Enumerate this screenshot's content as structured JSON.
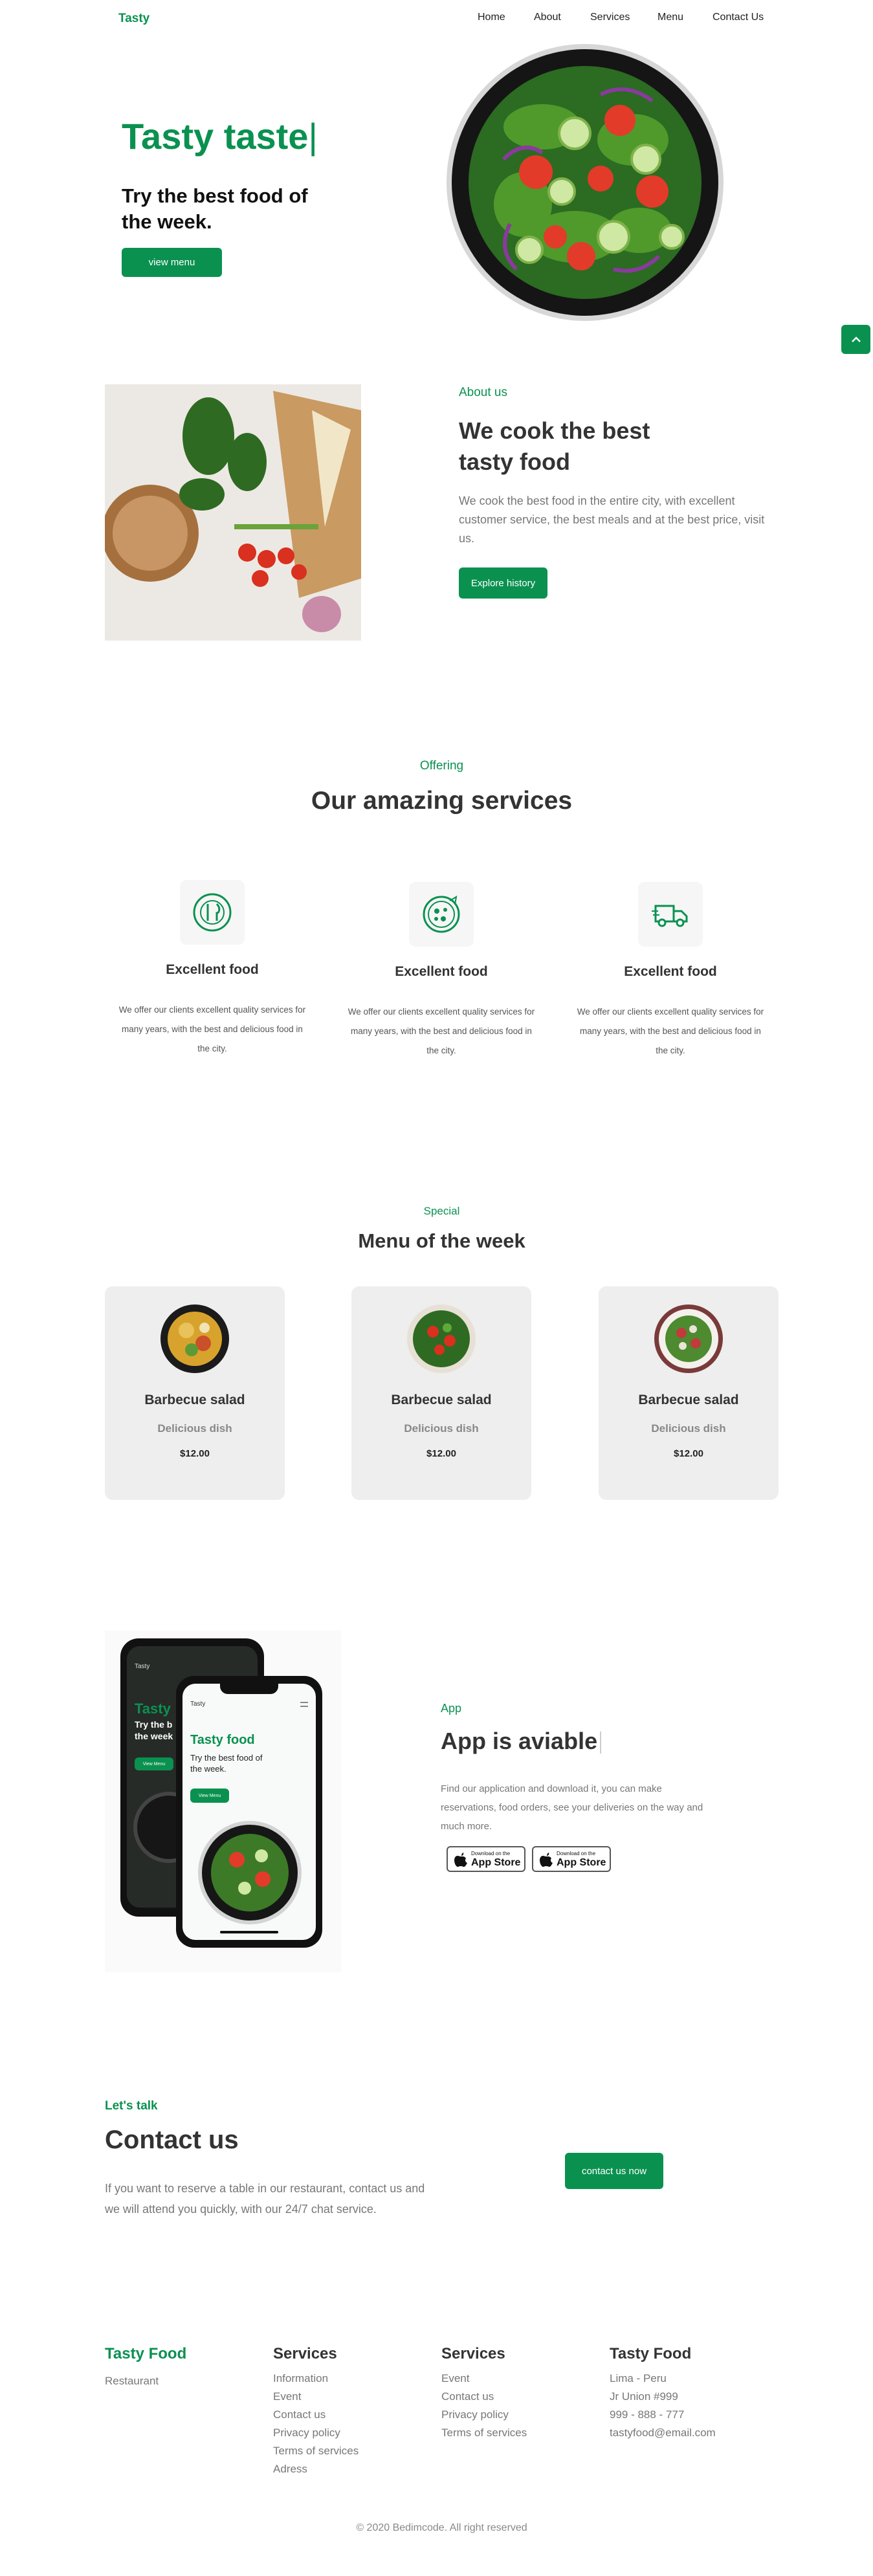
{
  "header": {
    "logo": "Tasty",
    "nav": [
      "Home",
      "About",
      "Services",
      "Menu",
      "Contact Us"
    ]
  },
  "hero": {
    "title": "Tasty taste",
    "cursor": "|",
    "subtitle": "Try the best food of the week.",
    "button": "view menu"
  },
  "about": {
    "eyebrow": "About us",
    "title": "We cook the best tasty food",
    "text": "We cook the best food in the entire city, with excellent customer service, the best meals and at the best price, visit us.",
    "button": "Explore history"
  },
  "services": {
    "eyebrow": "Offering",
    "title": "Our amazing services",
    "items": [
      {
        "icon": "cutlery-plate-icon",
        "title": "Excellent food",
        "text": "We offer our clients excellent quality services for many years, with the best and delicious food in the city."
      },
      {
        "icon": "pizza-icon",
        "title": "Excellent food",
        "text": "We offer our clients excellent quality services for many years, with the best and delicious food in the city."
      },
      {
        "icon": "delivery-truck-icon",
        "title": "Excellent food",
        "text": "We offer our clients excellent quality services for many years, with the best and delicious food in the city."
      }
    ]
  },
  "menu": {
    "eyebrow": "Special",
    "title": "Menu of the week",
    "items": [
      {
        "name": "Barbecue salad",
        "sub": "Delicious dish",
        "price": "$12.00"
      },
      {
        "name": "Barbecue salad",
        "sub": "Delicious dish",
        "price": "$12.00"
      },
      {
        "name": "Barbecue salad",
        "sub": "Delicious dish",
        "price": "$12.00"
      }
    ]
  },
  "app": {
    "eyebrow": "App",
    "title": "App is aviable",
    "text": "Find our application and download it, you can make reservations, food orders, see your deliveries on the way and much more.",
    "store_small": "Download on the",
    "store_big": "App Store",
    "phone_logo": "Tasty",
    "phone_title": "Tasty food",
    "phone_back_title": "Tasty",
    "phone_subtitle": "Try the best food of the week.",
    "phone_back_subtitle": "Try the b the week",
    "phone_button": "View Menu"
  },
  "contact": {
    "eyebrow": "Let's talk",
    "title": "Contact us",
    "text": "If you want to reserve a table in our restaurant, contact us and we will attend you quickly, with our 24/7 chat service.",
    "button": "contact us now"
  },
  "footer": {
    "brand": "Tasty Food",
    "brand_sub": "Restaurant",
    "col1": {
      "title": "Services",
      "items": [
        "Information",
        "Event",
        "Contact us",
        "Privacy policy",
        "Terms of services",
        "Adress"
      ]
    },
    "col2": {
      "title": "Services",
      "items": [
        "Event",
        "Contact us",
        "Privacy policy",
        "Terms of services"
      ]
    },
    "col3": {
      "title": "Tasty Food",
      "items": [
        "Lima - Peru",
        "Jr Union #999",
        "999 - 888 - 777",
        "tastyfood@email.com"
      ]
    },
    "copyright": "© 2020 Bedimcode. All right reserved"
  },
  "colors": {
    "accent": "#0a9150",
    "card": "#eeeeee"
  }
}
